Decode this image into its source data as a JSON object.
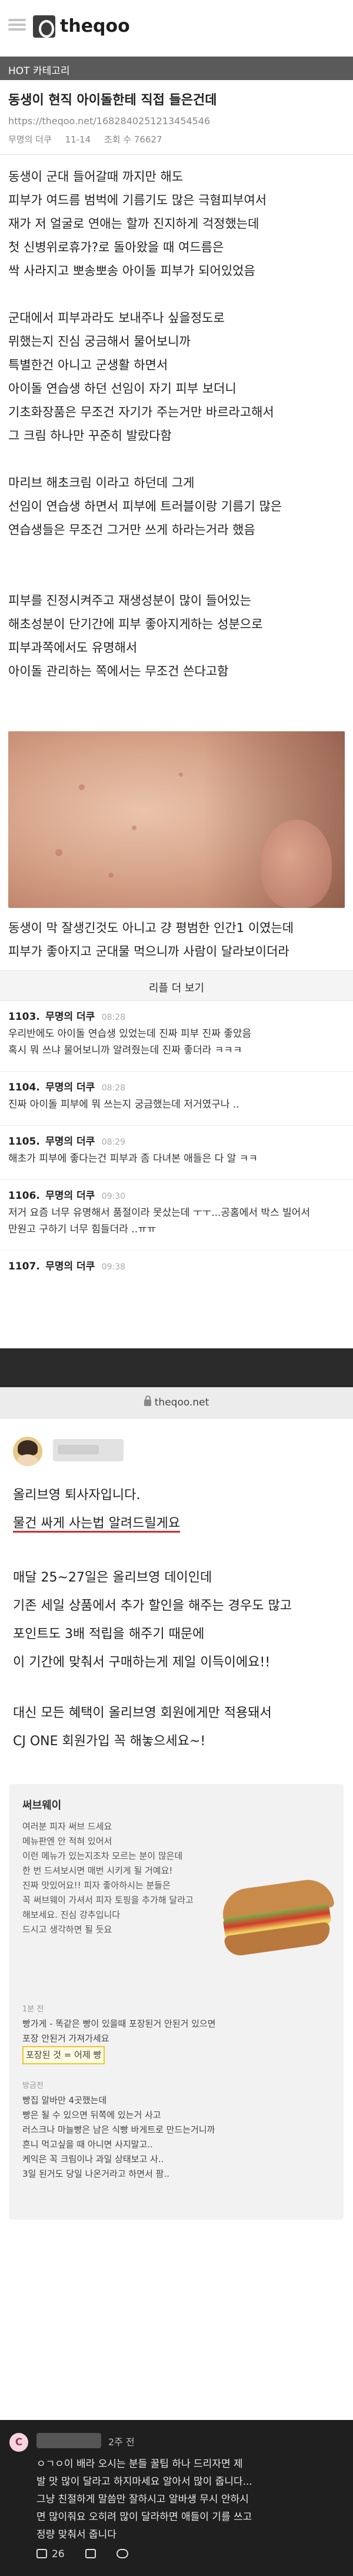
{
  "header": {
    "logo_text": "theqoo",
    "category": "HOT 카테고리"
  },
  "post": {
    "title": "동생이 현직 아이돌한테 직접 들은건데",
    "url": "https://theqoo.net/1682840251213454546",
    "meta": [
      "무명의 더쿠",
      "11-14",
      "조회 수 76627"
    ],
    "paragraphs": [
      [
        "동생이 군대 들어갈때 까지만 해도",
        "피부가 여드름 범벅에 기름기도 많은 극혐피부여서",
        "재가 저 얼굴로 연애는 할까 진지하게 걱정했는데",
        "첫 신병위로휴가?로 돌아왔을 때 여드름은",
        "싹 사라지고 뽀송뽀송 아이돌 피부가 되어있었음"
      ],
      [
        "군대에서 피부과라도 보내주나 싶을정도로",
        "뮈했는지 진심 궁금해서 물어보니까",
        "특별한건 아니고 군생활 하면서",
        "아이돌 연습생 하던 선임이 자기 피부 보더니",
        "기초화장품은 무조건 자기가 주는거만 바르라고해서",
        "그 크림 하나만 꾸준히 발랐다함"
      ],
      [
        "마리브 해초크림 이라고 하던데 그게",
        "선임이 연습생 하면서 피부에 트러블이랑 기름기 많은",
        "연습생들은 무조건 그거만 쓰게 하라는거라 했음"
      ],
      [
        "피부를 진정시켜주고 재생성분이 많이 들어있는",
        "해초성분이 단기간에 피부 좋아지게하는 성분으로",
        "피부과쪽에서도 유명해서",
        "아이돌 관리하는 쪽에서는 무조건 쓴다고함"
      ],
      [
        "동생이 막 잘생긴것도 아니고 걍 평범한 인간1 이였는데",
        "피부가 좋아지고 군대물 먹으니까 사람이 달라보이더라"
      ]
    ]
  },
  "more_label": "리플 더 보기",
  "comments": [
    {
      "no": "1103.",
      "author": "무명의 더쿠",
      "time": "08:28",
      "lines": [
        "우리반에도 아이돌 연습생 있었는데 진짜 피부 진짜 좋았음",
        "혹시 뭐 쓰냐 물어보니까 알려줬는데 진짜 좋더라 ㅋㅋㅋ"
      ]
    },
    {
      "no": "1104.",
      "author": "무명의 더쿠",
      "time": "08:28",
      "lines": [
        "진짜 아이돌 피부에 뭐 쓰는지 궁금했는데 저거였구나 .."
      ]
    },
    {
      "no": "1105.",
      "author": "무명의 더쿠",
      "time": "08:29",
      "lines": [
        "해초가 피부에 좋다는건 피부과 좀 다녀본 애들은 다 알 ㅋㅋ"
      ]
    },
    {
      "no": "1106.",
      "author": "무명의 더쿠",
      "time": "09:30",
      "lines": [
        "저거 요즘 너무 유명해서 품절이라 못샀는데 ㅜㅜ...공홈에서 박스 빌어서",
        "만원고 구하기 너무 힘들더라 ..ㅠㅠ"
      ]
    },
    {
      "no": "1107.",
      "author": "무명의 더쿠",
      "time": "09:38",
      "lines": []
    }
  ],
  "screenshot": {
    "url": "theqoo.net",
    "intro": "올리브영 퇴사자입니다.",
    "highlight": "물건 싸게 사는법 알려드릴게요",
    "block1": [
      "매달 25~27일은 올리브영 데이인데",
      "기존 세일 상품에서 추가 할인을 해주는 경우도 많고",
      "포인트도 3배 적립을 해주기 때문에",
      "이 기간에 맞춰서 구매하는게 제일 이득이에요!!"
    ],
    "block2": [
      "대신 모든 혜택이 올리브영 회원에게만 적용돼서",
      "CJ ONE 회원가입 꼭 해놓으세요~!"
    ],
    "card_title": "써브웨이",
    "card_lines": [
      "여러분 피자 써브 드세요",
      "메뉴판엔 안 적혀 있어서",
      "이런 메뉴가 있는지조차 모르는 분이 많은데",
      "한 번 드셔보시면 매번 시키게 될 거예요!",
      "진짜 맛있어요!! 피자 좋아하시는 분들은",
      "꼭 써브웨이 가셔서 피자 토핑을 추가해 달라고",
      "해보세요. 진심 강추입니다",
      "드시고 생각하면 될 듯요"
    ],
    "reply1_meta": "1분 전",
    "reply1_lines": [
      "빵가게 - 똑같은 빵이 있을때 포장된거 안된거 있으면",
      "포장 안된거 가져가세요"
    ],
    "reply1_highlight": "포장된 것 = 어제 빵",
    "reply2_meta": "방금전",
    "reply2_lines": [
      "빵집 알바만 4곳했는데",
      "빵은 될 수 있으면 뒤쪽에 있는거 사고",
      "러스크나 마늘빵은 남은 식빵 바게트로 만드는거니까",
      "흔니 먹고싶을 때 아니면 사지말고..",
      "케익은 꼭 크림이나 과일 상태보고 사..",
      "3일 된거도 당일 나온거라고 하면서 팜.."
    ]
  },
  "bottom_comment": {
    "avatar_letter": "C",
    "time": "2주 전",
    "lines": [
      "ㅇㄱㅇ이 배라 오시는 분들 꿀팁 하나 드리자면 제",
      "발 맛 많이 달라고 하지마세요 알아서 많이 줍니다...",
      "그냥 친절하게 말씀만 잘하시고 알바생 무시 안하시",
      "면 많이줘요 오히려 많이 달라하면 애들이 기를 쓰고",
      "정량 맞춰서 줍니다"
    ],
    "likes": "26"
  }
}
